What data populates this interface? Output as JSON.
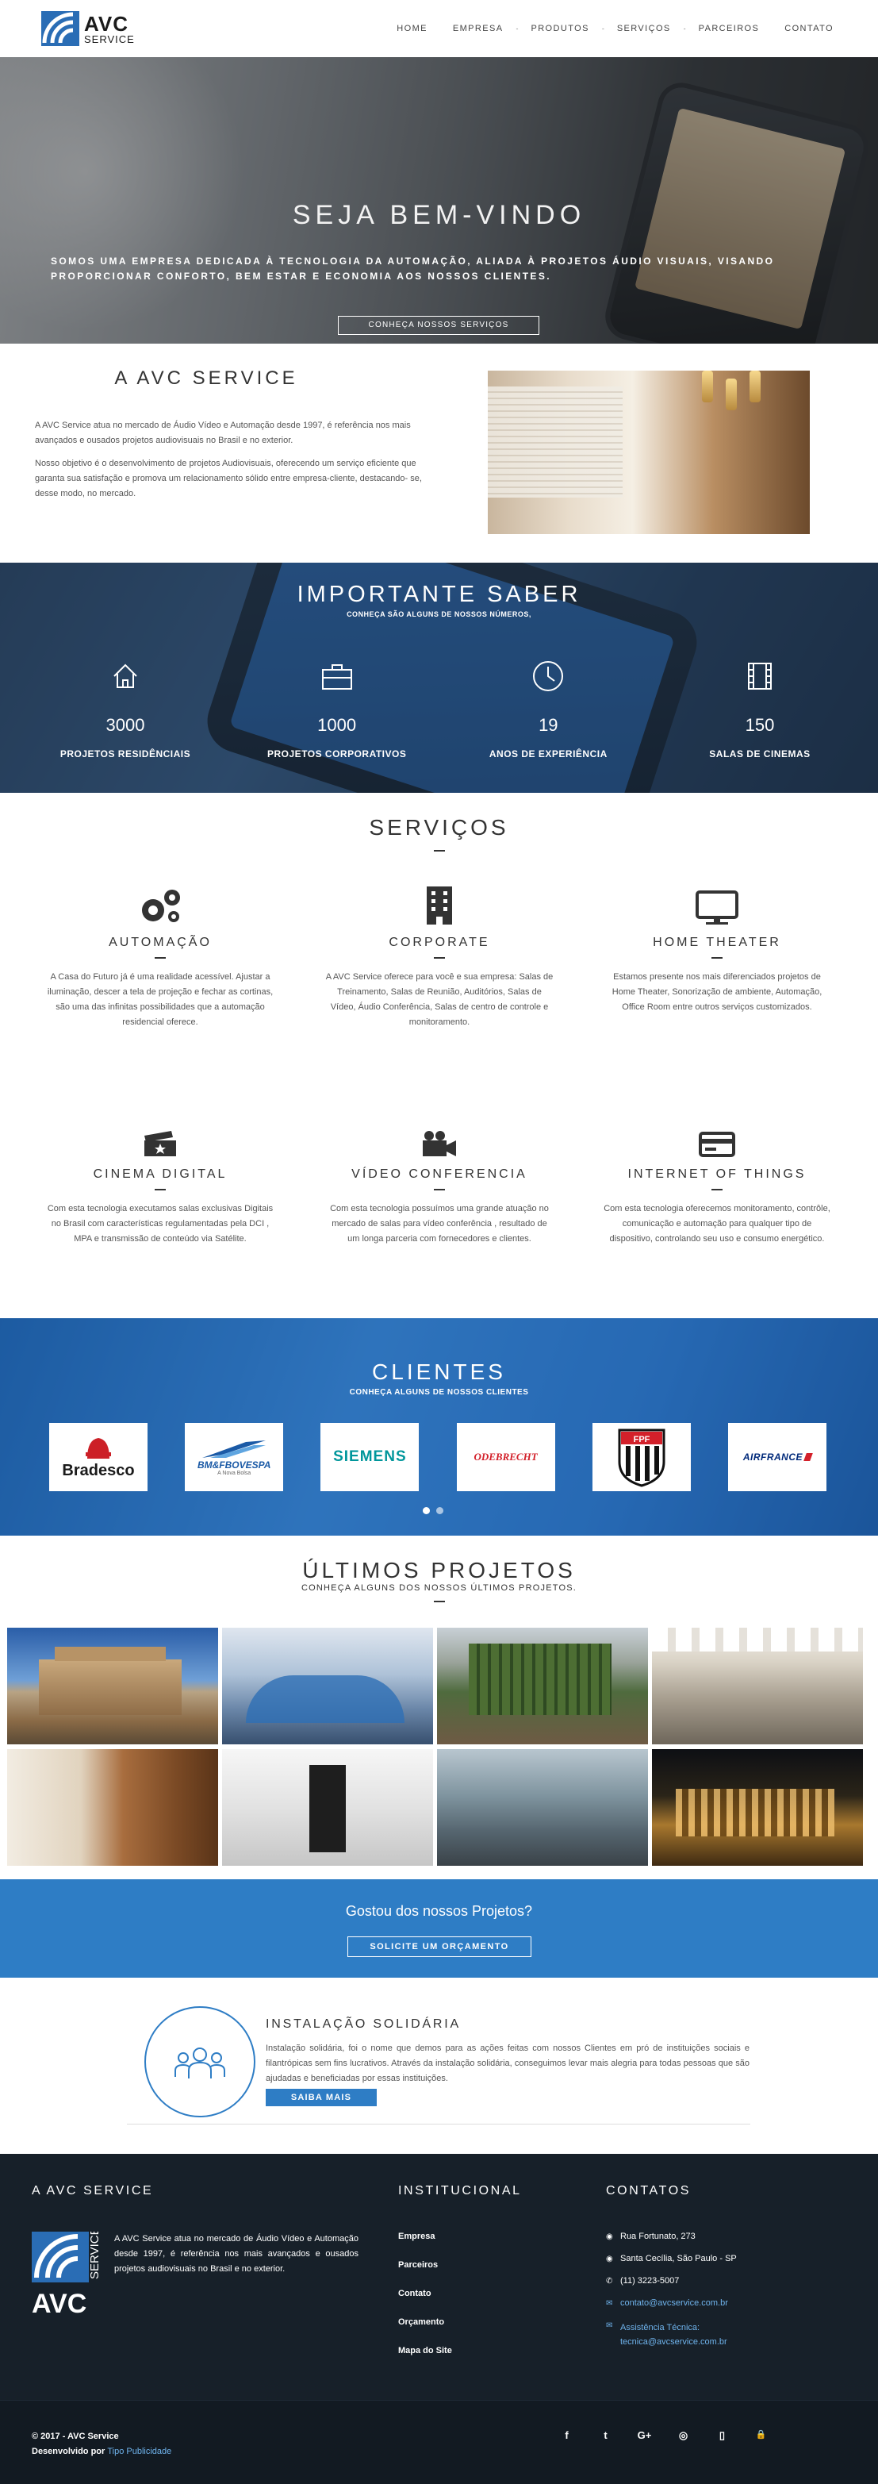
{
  "header": {
    "logo_main": "AVC",
    "logo_sub": "SERVICE",
    "nav": [
      {
        "label": "HOME"
      },
      {
        "label": "EMPRESA"
      },
      {
        "label": "PRODUTOS"
      },
      {
        "label": "SERVIÇOS"
      },
      {
        "label": "PARCEIROS"
      },
      {
        "label": "CONTATO"
      }
    ],
    "separator": "-"
  },
  "hero": {
    "title": "SEJA BEM-VINDO",
    "text": "SOMOS UMA EMPRESA DEDICADA À TECNOLOGIA DA AUTOMAÇÃO, ALIADA À PROJETOS ÁUDIO VISUAIS, VISANDO PROPORCIONAR CONFORTO, BEM ESTAR E ECONOMIA AOS NOSSOS CLIENTES.",
    "button": "CONHEÇA NOSSOS SERVIÇOS"
  },
  "about": {
    "title": "A AVC SERVICE",
    "p1": "A AVC Service atua no mercado de Áudio Vídeo e Automação desde 1997, é referência nos mais avançados e ousados projetos audiovisuais no Brasil e no exterior.",
    "p2": "Nosso objetivo é o desenvolvimento de projetos Audiovisuais, oferecendo um serviço eficiente que garanta sua satisfação e promova um relacionamento sólido entre empresa-cliente, destacando- se, desse modo, no mercado."
  },
  "numbers": {
    "title": "IMPORTANTE SABER",
    "subtitle": "CONHEÇA SÃO ALGUNS DE NOSSOS NÚMEROS,",
    "items": [
      {
        "icon": "house-icon",
        "value": "3000",
        "label": "PROJETOS RESIDÊNCIAIS"
      },
      {
        "icon": "briefcase-icon",
        "value": "1000",
        "label": "PROJETOS CORPORATIVOS"
      },
      {
        "icon": "clock-icon",
        "value": "19",
        "label": "ANOS DE EXPERIÊNCIA"
      },
      {
        "icon": "film-icon",
        "value": "150",
        "label": "SALAS DE CINEMAS"
      }
    ]
  },
  "services": {
    "title": "SERVIÇOS",
    "items": [
      {
        "icon": "gears-icon",
        "title": "AUTOMAÇÃO",
        "text": "A Casa do Futuro já é uma realidade acessível. Ajustar a iluminação, descer a tela de projeção e fechar as cortinas, são uma das infinitas possibilidades que a automação residencial oferece."
      },
      {
        "icon": "building-icon",
        "title": "CORPORATE",
        "text": "A AVC Service oferece para você e sua empresa: Salas de Treinamento, Salas de Reunião, Auditórios, Salas de Vídeo, Áudio Conferência, Salas de centro de controle e monitoramento."
      },
      {
        "icon": "monitor-icon",
        "title": "HOME THEATER",
        "text": "Estamos presente nos mais diferenciados projetos de Home Theater, Sonorização de ambiente, Automação, Office Room entre outros serviços customizados."
      },
      {
        "icon": "ticket-icon",
        "title": "CINEMA DIGITAL",
        "text": "Com esta tecnologia executamos salas exclusivas Digitais no Brasil com características regulamentadas pela DCI , MPA e transmissão de conteúdo via Satélite."
      },
      {
        "icon": "video-camera-icon",
        "title": "VÍDEO CONFERENCIA",
        "text": "Com esta tecnologia possuímos uma grande atuação no mercado de salas para vídeo conferência , resultado de um longa parceria com fornecedores e clientes."
      },
      {
        "icon": "card-icon",
        "title": "INTERNET OF THINGS",
        "text": "Com esta tecnologia oferecemos monitoramento, contrôle, comunicação e automação para qualquer tipo de dispositivo, controlando seu uso e consumo energético."
      }
    ]
  },
  "clients": {
    "title": "CLIENTES",
    "subtitle": "CONHEÇA ALGUNS DE NOSSOS CLIENTES",
    "logos": [
      {
        "name": "Bradesco"
      },
      {
        "name": "BM&FBOVESPA",
        "tagline": "A Nova Bolsa"
      },
      {
        "name": "SIEMENS"
      },
      {
        "name": "ODEBRECHT"
      },
      {
        "name": "FPF"
      },
      {
        "name": "AIRFRANCE"
      }
    ],
    "colors": {
      "bradesco": "#cc2027",
      "bovespa": "#1b5aa6",
      "siemens": "#00969b",
      "odebrecht": "#d3202a",
      "airfrance": "#00297a"
    }
  },
  "projects": {
    "title": "ÚLTIMOS PROJETOS",
    "subtitle": "CONHEÇA ALGUNS DOS NOSSOS ÚLTIMOS PROJETOS."
  },
  "cta": {
    "title": "Gostou dos nossos Projetos?",
    "button": "SOLICITE UM ORÇAMENTO"
  },
  "solidaria": {
    "title": "INSTALAÇÃO SOLIDÁRIA",
    "text": "Instalação solidária, foi o nome que demos para as ações feitas com nossos Clientes em pró de instituições sociais e filantrópicas sem fins lucrativos. Através da instalação solidária, conseguimos levar mais alegria para todas pessoas que são ajudadas e beneficiadas por essas instituições.",
    "button": "SAIBA MAIS",
    "icon": "people-icon"
  },
  "footer": {
    "col1_title": "A AVC SERVICE",
    "col1_text": "A AVC Service atua no mercado de Áudio Vídeo e Automação desde 1997, é referência nos mais avançados e ousados projetos audiovisuais no Brasil e no exterior.",
    "logo_main": "AVC",
    "logo_sub": "SERVICE",
    "col2_title": "INSTITUCIONAL",
    "links": [
      {
        "label": "Empresa"
      },
      {
        "label": "Parceiros"
      },
      {
        "label": "Contato"
      },
      {
        "label": "Orçamento"
      },
      {
        "label": "Mapa do Site"
      }
    ],
    "col3_title": "CONTATOS",
    "contacts": [
      {
        "icon": "map-marker-icon",
        "text": "Rua Fortunato, 273"
      },
      {
        "icon": "map-marker-icon",
        "text": "Santa Cecília, São Paulo - SP"
      },
      {
        "icon": "phone-icon",
        "text": "(11) 3223-5007"
      },
      {
        "icon": "envelope-icon",
        "text": "contato@avcservice.com.br"
      },
      {
        "icon": "envelope-icon",
        "text": "Assistência Técnica:",
        "text2": "tecnica@avcservice.com.br"
      }
    ],
    "copyright": "© 2017 - AVC Service",
    "dev_label": "Desenvolvido por",
    "dev_link": "Tipo Publicidade",
    "social": [
      {
        "icon": "facebook-icon",
        "glyph": "f"
      },
      {
        "icon": "twitter-icon",
        "glyph": "t"
      },
      {
        "icon": "google-plus-icon",
        "glyph": "G+"
      },
      {
        "icon": "instagram-icon",
        "glyph": "◎"
      },
      {
        "icon": "mobile-icon",
        "glyph": "▯"
      },
      {
        "icon": "lock-icon",
        "glyph": "🔒"
      }
    ]
  }
}
